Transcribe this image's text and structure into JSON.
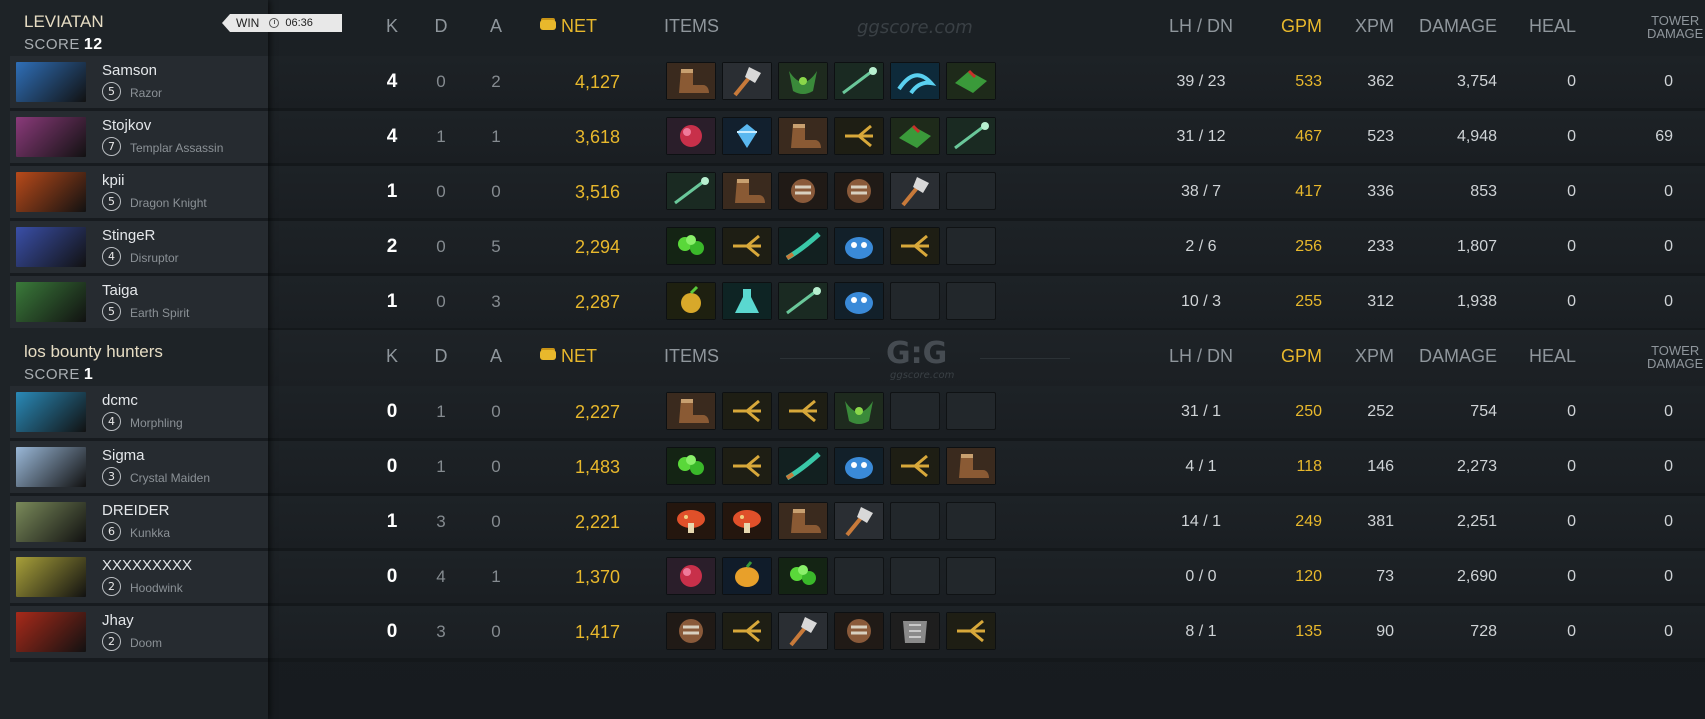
{
  "match": {
    "result": "WIN",
    "duration": "06:36"
  },
  "watermark": "ggscore.com",
  "watermark_logo": "G:G",
  "watermark_logo_sub": "ggscore.com",
  "headers": {
    "k": "K",
    "d": "D",
    "a": "A",
    "net": "NET",
    "items": "ITEMS",
    "lhdn": "LH  /  DN",
    "gpm": "GPM",
    "xpm": "XPM",
    "damage": "DAMAGE",
    "heal": "HEAL",
    "tower_line1": "TOWER",
    "tower_line2": "DAMAGE"
  },
  "teams": [
    {
      "name": "LEVIATAN",
      "score_label": "SCORE",
      "score": "12",
      "players": [
        {
          "name": "Samson",
          "level": "5",
          "hero": "Razor",
          "portrait_color": "#2f6fb8",
          "k": "4",
          "d": "0",
          "a": "2",
          "net": "4,127",
          "lhdn": "39  /  23",
          "gpm": "533",
          "xpm": "362",
          "damage": "3,754",
          "heal": "0",
          "tower": "0",
          "items": [
            "boots",
            "axe",
            "bracer",
            "staff",
            "swirl",
            "gloves"
          ]
        },
        {
          "name": "Stojkov",
          "level": "7",
          "hero": "Templar Assassin",
          "portrait_color": "#8a3a7a",
          "k": "4",
          "d": "1",
          "a": "1",
          "net": "3,618",
          "lhdn": "31  /  12",
          "gpm": "467",
          "xpm": "523",
          "damage": "4,948",
          "heal": "0",
          "tower": "69",
          "items": [
            "orb",
            "gem",
            "boots",
            "claw",
            "gloves",
            "staff"
          ]
        },
        {
          "name": "kpii",
          "level": "5",
          "hero": "Dragon Knight",
          "portrait_color": "#b84a1a",
          "k": "1",
          "d": "0",
          "a": "0",
          "net": "3,516",
          "lhdn": "38  /  7",
          "gpm": "417",
          "xpm": "336",
          "damage": "853",
          "heal": "0",
          "tower": "0",
          "items": [
            "staff",
            "boots",
            "gauntlet",
            "gauntlet",
            "axe",
            "empty"
          ]
        },
        {
          "name": "StingeR",
          "level": "4",
          "hero": "Disruptor",
          "portrait_color": "#3a4fa8",
          "k": "2",
          "d": "0",
          "a": "5",
          "net": "2,294",
          "lhdn": "2  /  6",
          "gpm": "256",
          "xpm": "233",
          "damage": "1,807",
          "heal": "0",
          "tower": "0",
          "items": [
            "tango",
            "claw",
            "branch",
            "ward",
            "claw",
            "empty"
          ]
        },
        {
          "name": "Taiga",
          "level": "5",
          "hero": "Earth Spirit",
          "portrait_color": "#3a7a3a",
          "k": "1",
          "d": "0",
          "a": "3",
          "net": "2,287",
          "lhdn": "10  /  3",
          "gpm": "255",
          "xpm": "312",
          "damage": "1,938",
          "heal": "0",
          "tower": "0",
          "items": [
            "fruit",
            "flask",
            "staff",
            "ward",
            "empty",
            "empty"
          ]
        }
      ]
    },
    {
      "name": "los bounty hunters",
      "score_label": "SCORE",
      "score": "1",
      "players": [
        {
          "name": "dcmc",
          "level": "4",
          "hero": "Morphling",
          "portrait_color": "#2a8ab8",
          "k": "0",
          "d": "1",
          "a": "0",
          "net": "2,227",
          "lhdn": "31  /  1",
          "gpm": "250",
          "xpm": "252",
          "damage": "754",
          "heal": "0",
          "tower": "0",
          "items": [
            "boots",
            "claw",
            "claw",
            "bracer",
            "empty",
            "empty"
          ]
        },
        {
          "name": "Sigma",
          "level": "3",
          "hero": "Crystal Maiden",
          "portrait_color": "#9ab8d8",
          "k": "0",
          "d": "1",
          "a": "0",
          "net": "1,483",
          "lhdn": "4  /  1",
          "gpm": "118",
          "xpm": "146",
          "damage": "2,273",
          "heal": "0",
          "tower": "0",
          "items": [
            "tango",
            "claw",
            "branch",
            "ward",
            "claw",
            "boots"
          ]
        },
        {
          "name": "DREIDER",
          "level": "6",
          "hero": "Kunkka",
          "portrait_color": "#7a8a5a",
          "k": "1",
          "d": "3",
          "a": "0",
          "net": "2,221",
          "lhdn": "14  /  1",
          "gpm": "249",
          "xpm": "381",
          "damage": "2,251",
          "heal": "0",
          "tower": "0",
          "items": [
            "mushroom",
            "mushroom",
            "boots",
            "axe",
            "empty",
            "empty"
          ]
        },
        {
          "name": "XXXXXXXXX",
          "level": "2",
          "hero": "Hoodwink",
          "portrait_color": "#a8a03a",
          "k": "0",
          "d": "4",
          "a": "1",
          "net": "1,370",
          "lhdn": "0  /  0",
          "gpm": "120",
          "xpm": "73",
          "damage": "2,690",
          "heal": "0",
          "tower": "0",
          "items": [
            "orb",
            "mango",
            "tango",
            "empty",
            "empty",
            "empty"
          ]
        },
        {
          "name": "Jhay",
          "level": "2",
          "hero": "Doom",
          "portrait_color": "#a82a1a",
          "k": "0",
          "d": "3",
          "a": "0",
          "net": "1,417",
          "lhdn": "8  /  1",
          "gpm": "135",
          "xpm": "90",
          "damage": "728",
          "heal": "0",
          "tower": "0",
          "items": [
            "gauntlet",
            "claw",
            "axe",
            "gauntlet",
            "armor",
            "claw"
          ]
        }
      ]
    }
  ],
  "colors": {
    "gold": "#e8b82c",
    "bg": "#171b1f",
    "panel": "#262b30"
  }
}
